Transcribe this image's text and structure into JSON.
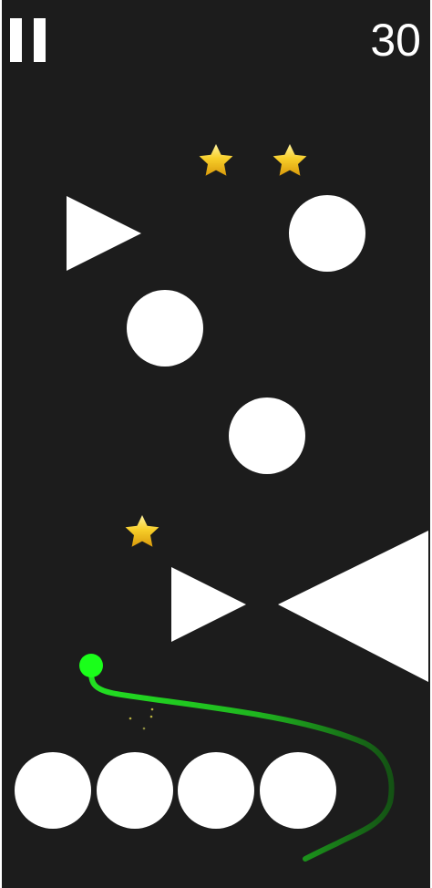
{
  "hud": {
    "score": "30"
  },
  "colors": {
    "background": "#1c1c1c",
    "shapes": "#ffffff",
    "player": "#1aff1a",
    "trail": "#22cc22",
    "star": "#f5c21c",
    "frame": "#ffffff"
  },
  "icons": {
    "pause": "pause-icon",
    "collectible": "star-icon"
  },
  "game": {
    "stars_visible": 3,
    "obstacle_circles": 3,
    "obstacle_triangles": 3,
    "bottom_balls": 4
  }
}
